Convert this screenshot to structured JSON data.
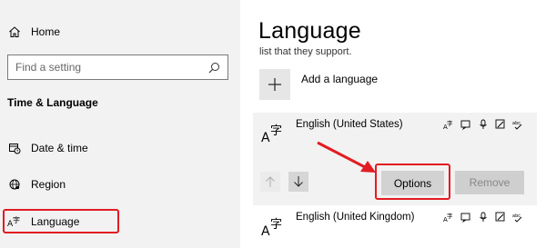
{
  "sidebar": {
    "home_label": "Home",
    "search_placeholder": "Find a setting",
    "section_title": "Time & Language",
    "items": [
      {
        "label": "Date & time",
        "icon": "clock-calendar-icon"
      },
      {
        "label": "Region",
        "icon": "globe-icon"
      },
      {
        "label": "Language",
        "icon": "language-icon"
      }
    ]
  },
  "main": {
    "title": "Language",
    "description": "list that they support.",
    "add_language_label": "Add a language",
    "languages": [
      {
        "name": "English (United States)",
        "icon": "language-glyph-icon",
        "features": [
          "display-language-icon",
          "text-to-speech-icon",
          "speech-recognition-icon",
          "handwriting-icon",
          "spell-check-icon"
        ]
      },
      {
        "name": "English (United Kingdom)",
        "icon": "language-glyph-icon",
        "features": [
          "display-language-icon",
          "text-to-speech-icon",
          "speech-recognition-icon",
          "handwriting-icon",
          "spell-check-icon"
        ]
      }
    ],
    "options_label": "Options",
    "remove_label": "Remove"
  },
  "colors": {
    "highlight": "#e31b23",
    "sidebar_bg": "#f2f2f2",
    "card_bg": "#f2f2f2"
  }
}
